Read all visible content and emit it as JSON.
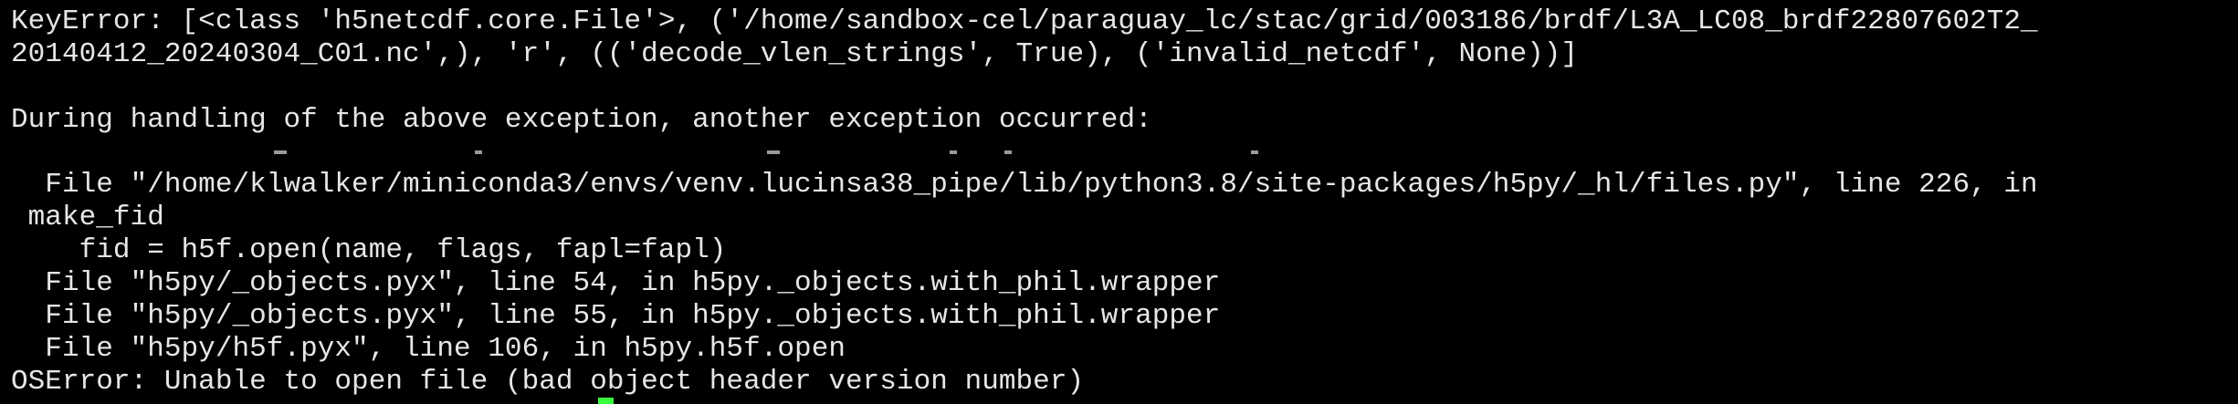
{
  "terminal": {
    "lines": [
      "KeyError: [<class 'h5netcdf.core.File'>, ('/home/sandbox-cel/paraguay_lc/stac/grid/003186/brdf/L3A_LC08_brdf22807602T2_",
      "20140412_20240304_C01.nc',), 'r', (('decode_vlen_strings', True), ('invalid_netcdf', None))]",
      "",
      "During handling of the above exception, another exception occurred:",
      "",
      "  File \"/home/klwalker/miniconda3/envs/venv.lucinsa38_pipe/lib/python3.8/site-packages/h5py/_hl/files.py\", line 226, in",
      " make_fid",
      "    fid = h5f.open(name, flags, fapl=fapl)",
      "  File \"h5py/_objects.pyx\", line 54, in h5py._objects.with_phil.wrapper",
      "  File \"h5py/_objects.pyx\", line 55, in h5py._objects.with_phil.wrapper",
      "  File \"h5py/h5f.pyx\", line 106, in h5py.h5f.open",
      "OSError: Unable to open file (bad object header version number)"
    ],
    "cursor_color": "#3cff3c",
    "text_color": "#e6e6e6",
    "background": "#000000"
  }
}
